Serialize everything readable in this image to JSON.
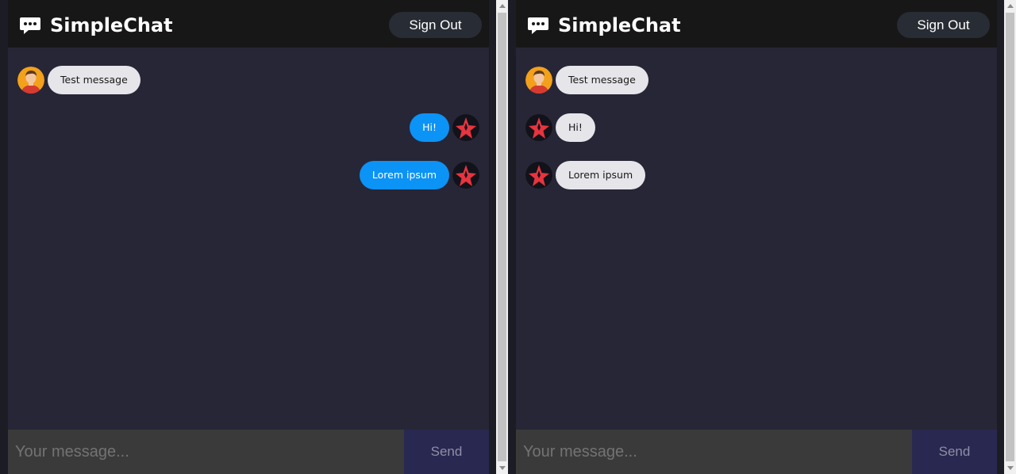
{
  "windows": [
    {
      "app_title": "SimpleChat",
      "sign_out_label": "Sign Out",
      "input_placeholder": "Your message...",
      "send_label": "Send",
      "messages": [
        {
          "text": "Test message",
          "direction": "received",
          "avatar": "user-face-avatar"
        },
        {
          "text": "Hi!",
          "direction": "sent",
          "avatar": "star-logo-avatar"
        },
        {
          "text": "Lorem ipsum",
          "direction": "sent",
          "avatar": "star-logo-avatar"
        }
      ]
    },
    {
      "app_title": "SimpleChat",
      "sign_out_label": "Sign Out",
      "input_placeholder": "Your message...",
      "send_label": "Send",
      "messages": [
        {
          "text": "Test message",
          "direction": "received",
          "avatar": "user-face-avatar"
        },
        {
          "text": "Hi!",
          "direction": "received",
          "avatar": "star-logo-avatar"
        },
        {
          "text": "Lorem ipsum",
          "direction": "received",
          "avatar": "star-logo-avatar"
        }
      ]
    }
  ],
  "colors": {
    "header_bg": "#181717",
    "chat_bg": "#272636",
    "sent_bubble": "#0b93f6",
    "received_bubble": "#e5e5ea",
    "send_button_bg": "#292850",
    "input_bg": "#3a3a3a"
  }
}
